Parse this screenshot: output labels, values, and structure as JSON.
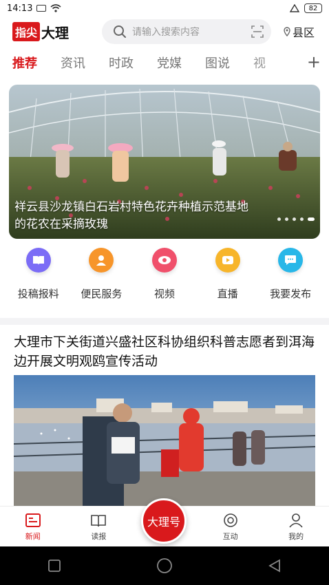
{
  "status_bar": {
    "time": "14:13",
    "battery": "82"
  },
  "header": {
    "logo_red": "指尖",
    "logo_black": "大理",
    "search_placeholder": "请输入搜索内容",
    "region": "县区"
  },
  "tabs": [
    {
      "label": "推荐",
      "active": true
    },
    {
      "label": "资讯"
    },
    {
      "label": "时政"
    },
    {
      "label": "党媒"
    },
    {
      "label": "图说"
    },
    {
      "label": "视"
    }
  ],
  "banner": {
    "caption": "祥云县沙龙镇白石岩村特色花卉种植示范基地的花农在采摘玫瑰",
    "slide_count": 5,
    "current_slide": 5
  },
  "quick_entries": [
    {
      "label": "投稿报料",
      "icon": "book-icon",
      "color": "#7b6cf6"
    },
    {
      "label": "便民服务",
      "icon": "user-icon",
      "color": "#f7952a"
    },
    {
      "label": "视频",
      "icon": "eye-icon",
      "color": "#f0506b"
    },
    {
      "label": "直播",
      "icon": "video-icon",
      "color": "#f7b52a"
    },
    {
      "label": "我要发布",
      "icon": "chat-icon",
      "color": "#28b7e8"
    }
  ],
  "article": {
    "title": "大理市下关街道兴盛社区科协组织科普志愿者到洱海边开展文明观鸥宣传活动"
  },
  "bottom_nav": [
    {
      "label": "新闻",
      "icon": "news-icon",
      "active": true
    },
    {
      "label": "读报",
      "icon": "read-icon"
    },
    {
      "label": "大理号",
      "icon": "center"
    },
    {
      "label": "互动",
      "icon": "interact-icon"
    },
    {
      "label": "我的",
      "icon": "profile-icon"
    }
  ],
  "colors": {
    "accent": "#d9191c"
  }
}
